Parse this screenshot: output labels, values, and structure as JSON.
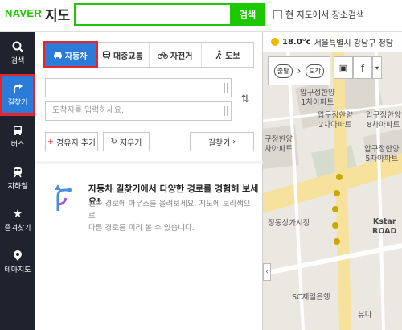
{
  "header": {
    "logo": "NAVER",
    "title": "지도",
    "search_value": "",
    "search_button": "검색",
    "scope_label": "현 지도에서 장소검색"
  },
  "nav": [
    {
      "icon": "search-icon",
      "label": "검색"
    },
    {
      "icon": "directions-icon",
      "label": "길찾기"
    },
    {
      "icon": "bus-icon",
      "label": "버스"
    },
    {
      "icon": "subway-icon",
      "label": "지하철"
    },
    {
      "icon": "star-icon",
      "label": "즐겨찾기"
    },
    {
      "icon": "pin-icon",
      "label": "테마지도"
    }
  ],
  "route": {
    "tabs": [
      {
        "icon": "car-icon",
        "label": "자동차",
        "active": true
      },
      {
        "icon": "transit-icon",
        "label": "대중교통"
      },
      {
        "icon": "bicycle-icon",
        "label": "자전거"
      },
      {
        "icon": "walk-icon",
        "label": "도보"
      }
    ],
    "origin_placeholder": "",
    "destination_placeholder": "도착지를 입력하세요.",
    "add_waypoint": "경유지 추가",
    "clear": "지우기",
    "find": "길찾기"
  },
  "info": {
    "title": "자동차 길찾기에서 다양한 경로를 경험해 보세요!",
    "line1": "왼쪽 경로에 마우스를 올려보세요. 지도에 보라색으로",
    "line2": "다른 경로를 미리 볼 수 있습니다."
  },
  "map": {
    "temperature": "18.0°c",
    "location": "서울특별시 강남구 청담",
    "start_label": "출발",
    "end_label": "도착",
    "labels": [
      "압구정한양",
      "1차아파트",
      "압구정한양",
      "2차아파트",
      "압구정한양",
      "8차아파트",
      "구정한양",
      "차아파트",
      "압구정한양",
      "5차아파트",
      "정동상가시장",
      "Kstar",
      "ROAD",
      "SC제일은행",
      "유다"
    ]
  },
  "colors": {
    "accent": "#1ec800",
    "active_blue": "#2b7bd9",
    "highlight_red": "#e8232a",
    "nav_dark": "#1e232d"
  }
}
